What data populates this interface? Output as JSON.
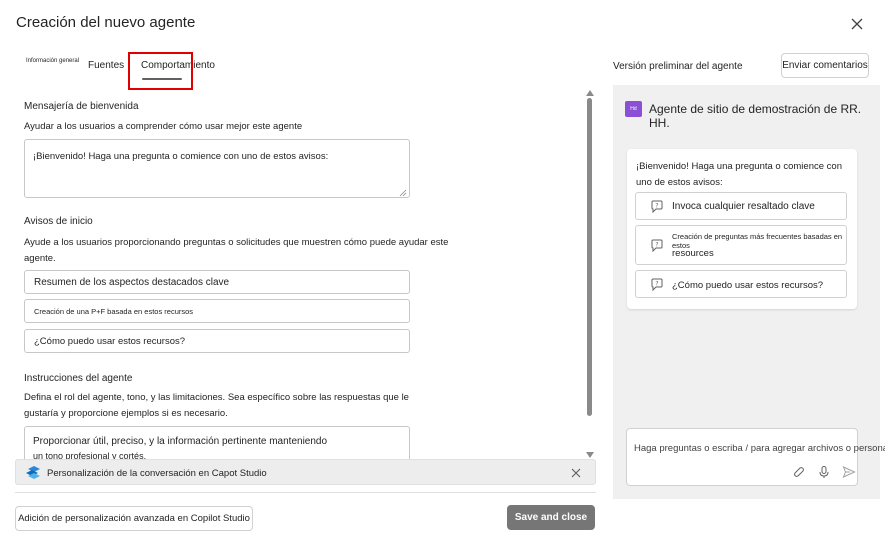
{
  "dialog": {
    "title": "Creación del nuevo agente"
  },
  "tabs": [
    {
      "label": "Información general"
    },
    {
      "label": "Fuentes"
    },
    {
      "label": "Comportamiento"
    }
  ],
  "preview": {
    "label": "Versión preliminar del agente",
    "feedback_button": "Enviar comentarios",
    "avatar_initials": "Hd",
    "agent_name": "Agente de sitio de demostración de RR. HH.",
    "welcome_message": "¡Bienvenido! Haga una pregunta o comience con uno de estos avisos:",
    "suggestions": [
      {
        "label": "Invoca cualquier resaltado clave"
      },
      {
        "label_line1": "Creación de preguntas más frecuentes basadas en estos",
        "label_line2": "resources"
      },
      {
        "label": "¿Cómo puedo usar estos recursos?"
      }
    ],
    "input_placeholder": "Haga preguntas o escriba / para agregar archivos o personas."
  },
  "welcome_section": {
    "heading": "Mensajería de bienvenida",
    "description": "Ayudar a los usuarios a comprender cómo usar mejor este agente",
    "value": "¡Bienvenido! Haga una pregunta o comience con uno de estos avisos:"
  },
  "starter_section": {
    "heading": "Avisos de inicio",
    "description_line1": "Ayude a los usuarios proporcionando preguntas o solicitudes que muestren cómo puede ayudar este",
    "description_line2": "agente.",
    "prompts": [
      {
        "value": "Resumen de los aspectos destacados clave"
      },
      {
        "value": "Creación de una P+F basada en estos recursos"
      },
      {
        "value": "¿Cómo puedo usar estos recursos?"
      }
    ]
  },
  "instructions_section": {
    "heading": "Instrucciones del agente",
    "description_line1": "Defina el rol del agente, tono, y las limitaciones. Sea específico sobre las respuestas que le",
    "description_line2": "gustaría y proporcione ejemplos si es necesario.",
    "value_line1": "Proporcionar útil, preciso, y la información pertinente manteniendo",
    "value_line2": "un tono profesional y cortés."
  },
  "banner": {
    "text": "Personalización de la conversación en Capot Studio"
  },
  "footer": {
    "advanced_button": "Adición de personalización avanzada en Copilot Studio",
    "save_button": "Save and close"
  },
  "colors": {
    "highlight": "#e00000",
    "avatar": "#8b4fd6",
    "save_button": "#767676",
    "preview_background": "#f0f0f0"
  },
  "icons": [
    "close-icon",
    "chat-help-icon",
    "copilot-studio-icon",
    "attach-icon",
    "microphone-icon",
    "send-icon"
  ]
}
